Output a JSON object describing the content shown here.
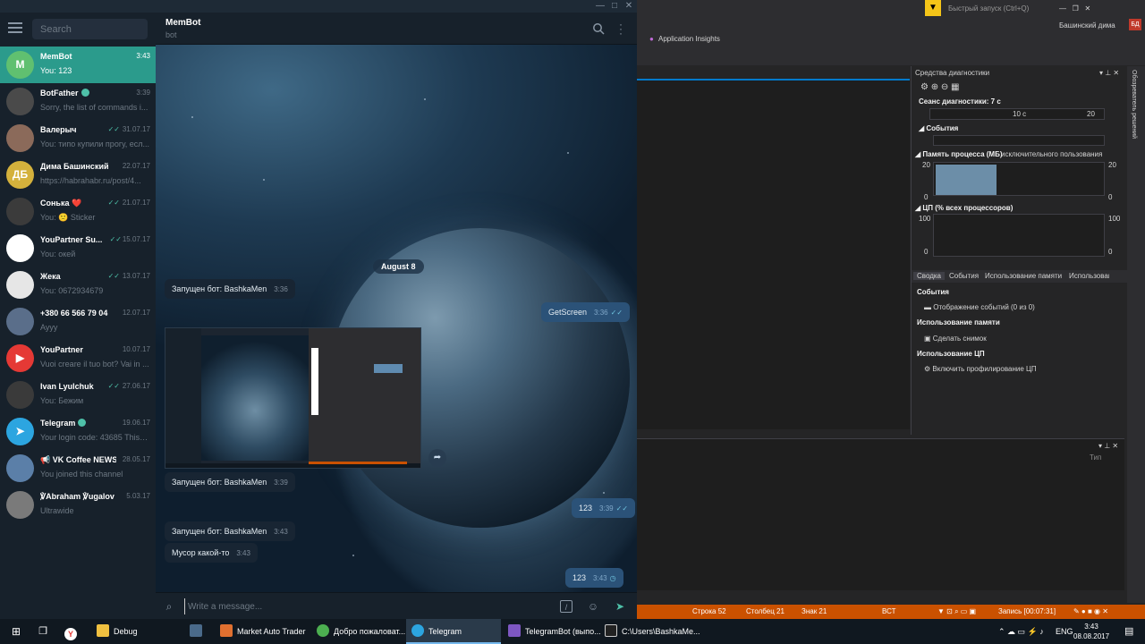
{
  "telegram": {
    "search_placeholder": "Search",
    "chats": [
      {
        "name": "MemBot",
        "time": "3:43",
        "preview": "You: 123",
        "avatar_letter": "M",
        "avatar_color": "#60c070",
        "active": true
      },
      {
        "name": "BotFather",
        "time": "3:39",
        "preview": "Sorry, the list of commands i...",
        "avatar_color": "#4a4a4a",
        "verified": true
      },
      {
        "name": "Валерыч",
        "time": "31.07.17",
        "preview": "You: типо купили прогу, есл...",
        "avatar_color": "#8b6a5a"
      },
      {
        "name": "Дима Башинский",
        "time": "22.07.17",
        "preview": "https://habrahabr.ru/post/4...",
        "avatar_letter": "ДБ",
        "avatar_color": "#d4b13c"
      },
      {
        "name": "Сонька ❤️",
        "time": "21.07.17",
        "preview": "You: 🙁 Sticker",
        "avatar_color": "#3b3b3b"
      },
      {
        "name": "YouPartner Su...",
        "time": "15.07.17",
        "preview": "You: окей",
        "avatar_color": "#ffffff"
      },
      {
        "name": "Жека",
        "time": "13.07.17",
        "preview": "You: 0672934679",
        "avatar_color": "#e6e6e6"
      },
      {
        "name": "+380 66 566 79 04",
        "time": "12.07.17",
        "preview": "Ayyy",
        "avatar_color": "#5a6e8a"
      },
      {
        "name": "YouPartner",
        "time": "10.07.17",
        "preview": "Vuoi creare il tuo bot? Vai in ...",
        "avatar_color": "#e53935"
      },
      {
        "name": "Ivan Lyulchuk",
        "time": "27.06.17",
        "preview": "You: Бежим",
        "avatar_color": "#3a3a3a"
      },
      {
        "name": "Telegram",
        "time": "19.06.17",
        "preview": "Your login code: 43685  This c...",
        "avatar_color": "#2ca5e0",
        "verified": true
      },
      {
        "name": "📢 VK Coffee NEWS",
        "time": "28.05.17",
        "preview": "You joined this channel",
        "avatar_color": "#5b7fa8"
      },
      {
        "name": "℣Abraham ℣ugalov",
        "time": "5.03.17",
        "preview": "Ultrawide",
        "avatar_color": "#7a7a7a"
      }
    ],
    "header": {
      "title": "MemBot",
      "subtitle": "bot"
    },
    "date_separator": "August 8",
    "messages": [
      {
        "id": "m1",
        "text": "Запущен бот: BashkaMen",
        "time": "3:36",
        "dir": "in"
      },
      {
        "id": "m2",
        "text": "GetScreen",
        "time": "3:36",
        "dir": "out"
      },
      {
        "id": "m3",
        "text": "Запущен бот: BashkaMen",
        "time": "3:39",
        "dir": "in"
      },
      {
        "id": "m4",
        "text": "123",
        "time": "3:39",
        "dir": "out"
      },
      {
        "id": "m5",
        "text": "Запущен бот: BashkaMen",
        "time": "3:43",
        "dir": "in"
      },
      {
        "id": "m6",
        "text": "Мусор какой-то",
        "time": "3:43",
        "dir": "in"
      },
      {
        "id": "m7",
        "text": "123",
        "time": "3:43",
        "dir": "out"
      }
    ],
    "input_placeholder": "Write a message..."
  },
  "vs": {
    "quick_launch": "Быстрый запуск (Ctrl+Q)",
    "user": "Башинский дима",
    "user_initials": "БД",
    "app_insights": "Application Insights",
    "solution_explorer_tab": "Обозреватель решений",
    "diag": {
      "title": "Средства диагностики",
      "session": "Сеанс диагностики: 7 с",
      "ruler": [
        "10 с",
        "20"
      ],
      "events": "События",
      "memory": "Память процесса (МБ)",
      "memory_legend": "исключительного пользования",
      "memory_scale": [
        "20",
        "0"
      ],
      "cpu": "ЦП (% всех процессоров)",
      "cpu_scale": [
        "100",
        "0"
      ],
      "tabs": [
        "Сводка",
        "События",
        "Использование памяти",
        "Использован"
      ],
      "sections": [
        {
          "head": "События",
          "item": "Отображение событий (0 из 0)"
        },
        {
          "head": "Использование памяти",
          "item": "Сделать снимок"
        },
        {
          "head": "Использование ЦП",
          "item": "Включить профилирование ЦП"
        }
      ]
    },
    "bottom_col": "Тип",
    "status": {
      "line": "Строка 52",
      "col": "Столбец 21",
      "char": "Знак 21",
      "mode": "ВСТ",
      "record": "Запись [00:07:31]"
    }
  },
  "taskbar": {
    "items": [
      {
        "label": "Debug",
        "color": "#f0c040"
      },
      {
        "label": "Market Auto Trader",
        "color": "#e07030"
      },
      {
        "label": "Добро пожаловат...",
        "color": "#4caf50"
      },
      {
        "label": "Telegram",
        "color": "#2ca5e0"
      },
      {
        "label": "TelegramBot (выпо...",
        "color": "#7e57c2"
      },
      {
        "label": "C:\\Users\\BashkaMe...",
        "color": "#cccccc"
      }
    ],
    "lang": "ENG",
    "time": "3:43",
    "date": "08.08.2017"
  }
}
